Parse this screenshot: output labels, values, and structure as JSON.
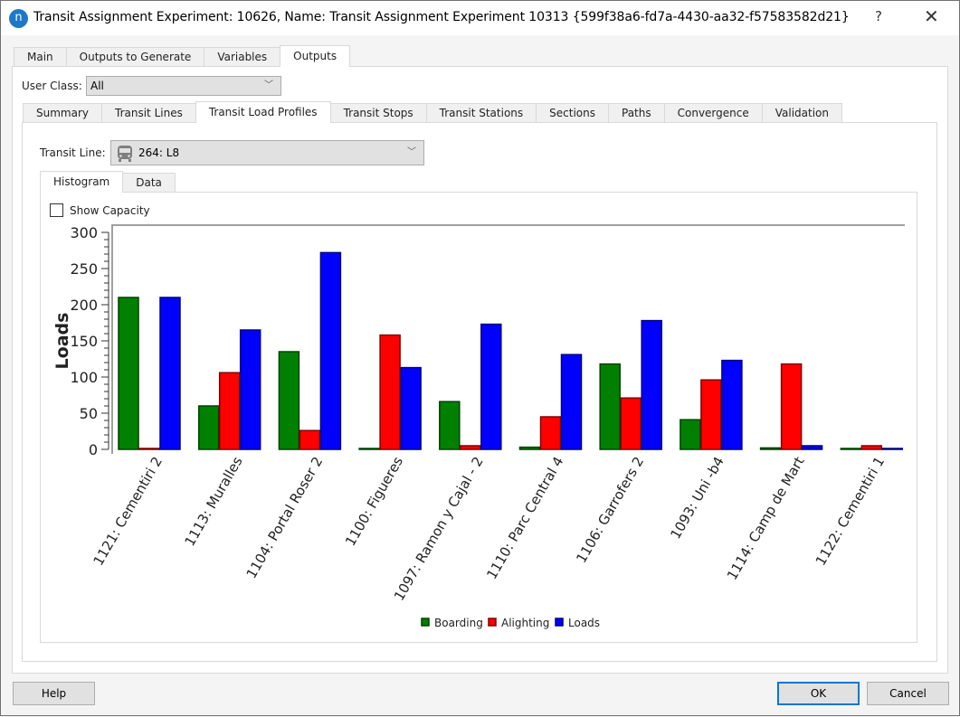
{
  "window": {
    "title": "Transit Assignment Experiment: 10626, Name: Transit Assignment Experiment 10313  {599f38a6-fd7a-4430-aa32-f57583582d21}",
    "logo_letter": "n",
    "help_glyph": "?",
    "close_glyph": "✕"
  },
  "main_tabs": [
    {
      "label": "Main",
      "active": false
    },
    {
      "label": "Outputs to Generate",
      "active": false
    },
    {
      "label": "Variables",
      "active": false
    },
    {
      "label": "Outputs",
      "active": true
    }
  ],
  "user_class": {
    "label": "User Class:",
    "value": "All"
  },
  "output_tabs": [
    {
      "label": "Summary",
      "active": false
    },
    {
      "label": "Transit Lines",
      "active": false
    },
    {
      "label": "Transit Load Profiles",
      "active": true
    },
    {
      "label": "Transit Stops",
      "active": false
    },
    {
      "label": "Transit Stations",
      "active": false
    },
    {
      "label": "Sections",
      "active": false
    },
    {
      "label": "Paths",
      "active": false
    },
    {
      "label": "Convergence",
      "active": false
    },
    {
      "label": "Validation",
      "active": false
    }
  ],
  "transit_line": {
    "label": "Transit Line:",
    "value": "264: L8",
    "icon": "bus-icon"
  },
  "view_tabs": [
    {
      "label": "Histogram",
      "active": true
    },
    {
      "label": "Data",
      "active": false
    }
  ],
  "show_capacity": {
    "label": "Show Capacity",
    "checked": false
  },
  "chart_data": {
    "type": "bar",
    "title": "",
    "xlabel": "",
    "ylabel": "Loads",
    "ylim": [
      0,
      300
    ],
    "yticks": [
      0,
      50,
      100,
      150,
      200,
      250,
      300
    ],
    "grid": false,
    "legend_position": "bottom-center",
    "categories": [
      "1121: Cementiri 2",
      "1113: Muralles",
      "1104: Portal Roser 2",
      "1100: Figueres",
      "1097: Ramon y Cajal - 2",
      "1110: Parc Central 4",
      "1106: Garrofers 2",
      "1093: Uni -b4",
      "1114: Camp de Mart",
      "1122: Cementiri 1"
    ],
    "series": [
      {
        "name": "Boarding",
        "color": "#008000",
        "stroke": "#004000",
        "values": [
          210,
          60,
          135,
          0,
          66,
          3,
          118,
          41,
          2,
          0
        ]
      },
      {
        "name": "Alighting",
        "color": "#ff0000",
        "stroke": "#800000",
        "values": [
          0,
          106,
          26,
          158,
          5,
          45,
          71,
          96,
          118,
          5
        ]
      },
      {
        "name": "Loads",
        "color": "#0000ff",
        "stroke": "#000080",
        "values": [
          210,
          165,
          272,
          113,
          173,
          131,
          178,
          123,
          5,
          0
        ]
      }
    ]
  },
  "buttons": {
    "help": "Help",
    "ok": "OK",
    "cancel": "Cancel"
  }
}
